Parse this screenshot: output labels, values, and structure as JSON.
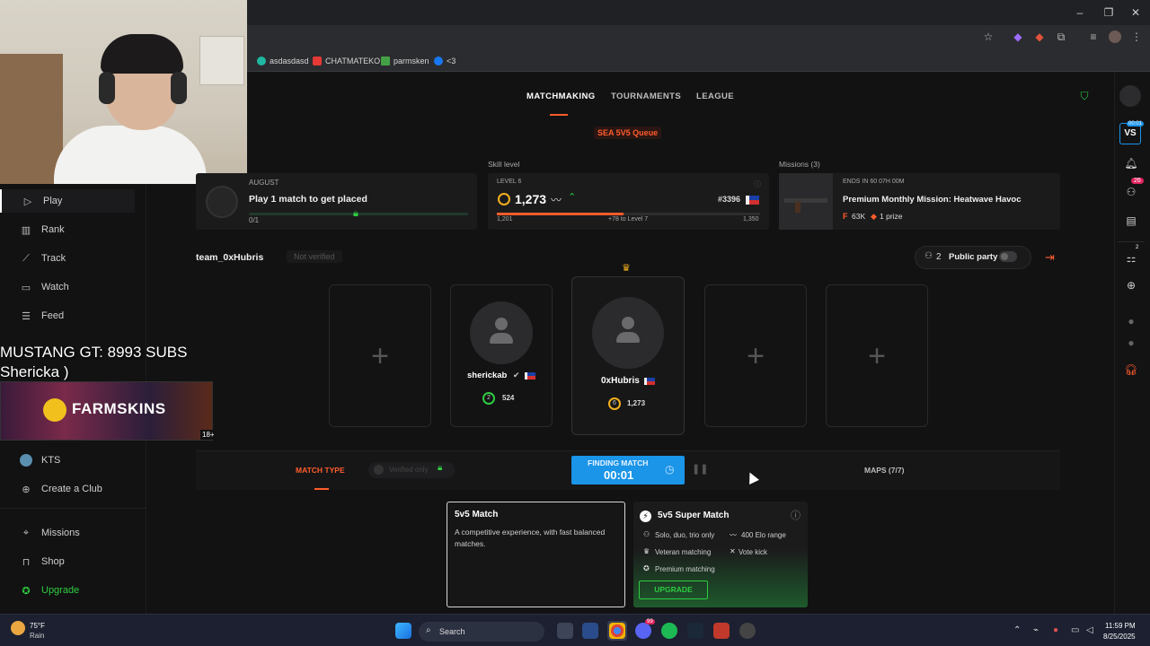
{
  "bookmarks": [
    {
      "label": "asdasdasd",
      "color": "#1fb8a2"
    },
    {
      "label": "CHATMATEKO",
      "color": "#e53935"
    },
    {
      "label": "parmsken",
      "color": "#43a047"
    },
    {
      "label": "<3",
      "color": "#1877f2"
    }
  ],
  "nav": {
    "items": [
      "Play",
      "Rank",
      "Track",
      "Watch",
      "Feed"
    ],
    "kts": "KTS",
    "create_club": "Create a Club",
    "missions": "Missions",
    "shop": "Shop",
    "upgrade": "Upgrade"
  },
  "stream_overlay": {
    "line1": "MUSTANG GT: 8993 SUBS",
    "line2": "Shericka )",
    "ad_brand": "FARMSKINS",
    "ad_badge": "18+"
  },
  "tabs": [
    "MATCHMAKING",
    "TOURNAMENTS",
    "LEAGUE"
  ],
  "queue_label": "SEA 5V5 Queue",
  "placement": {
    "month": "AUGUST",
    "title": "Play 1 match to get placed",
    "progress_text": "0/1",
    "progress": 0
  },
  "skill": {
    "heading": "Skill level",
    "level": "LEVEL 6",
    "elo": "1,273",
    "rank": "#3396",
    "min": "1,201",
    "to_next": "+78 to Level 7",
    "max": "1,350",
    "progress": 0.48
  },
  "missions": {
    "heading": "Missions (3)",
    "ends": "ENDS IN 60 07H 00M",
    "title": "Premium Monthly Mission: Heatwave Havoc",
    "reward_points": "63K",
    "reward_prize": "1 prize"
  },
  "team": {
    "name": "team_0xHubris",
    "verified": "Not verified",
    "party_count": "2",
    "party_label": "Public party"
  },
  "players": [
    {
      "name": "sherickab",
      "level": "2",
      "elo": "524"
    },
    {
      "name": "0xHubris",
      "level": "6",
      "elo": "1,273"
    }
  ],
  "match_bar": {
    "match_type": "MATCH TYPE",
    "verified_only": "Verified only",
    "finding": "FINDING MATCH",
    "timer": "00:01",
    "maps": "MAPS (7/7)"
  },
  "match_5v5": {
    "title": "5v5 Match",
    "desc": "A competitive experience, with fast balanced matches."
  },
  "match_super": {
    "title": "5v5 Super Match",
    "f1": "Solo, duo, trio only",
    "f2": "400 Elo range",
    "f3": "Veteran matching",
    "f4": "Vote kick",
    "f5": "Premium matching",
    "cta": "UPGRADE"
  },
  "rail": {
    "vs_badge": "00:01",
    "vs": "VS",
    "notif_count": "26",
    "party_count": "2"
  },
  "taskbar": {
    "temp": "75°F",
    "weather": "Rain",
    "search": "Search",
    "time": "11:59 PM",
    "date": "8/25/2025",
    "discord_badge": "99"
  },
  "colors": {
    "accent": "#ff5c2b",
    "finding": "#1a95e8",
    "green": "#2ecc40"
  }
}
